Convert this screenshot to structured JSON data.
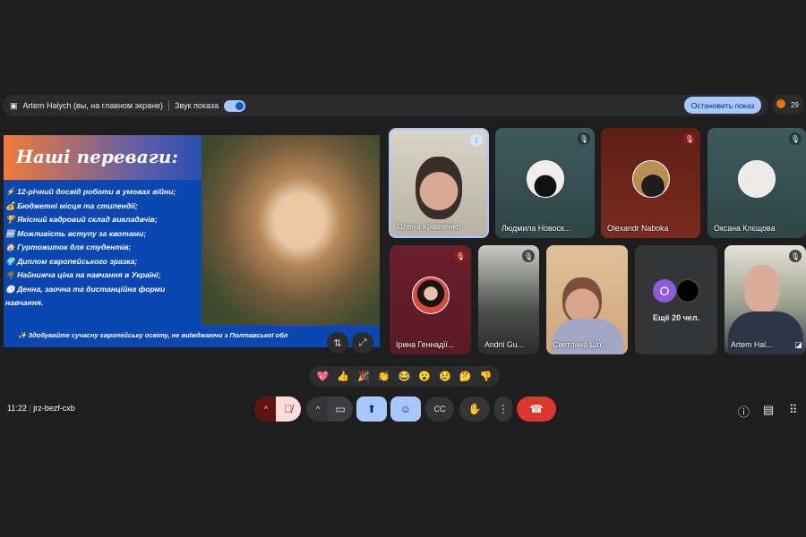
{
  "topbar": {
    "presenter": "Artem Halych (вы, на главном экране)",
    "sound_label": "Звук показа",
    "stop_label": "Остановить показ",
    "participant_count": "29"
  },
  "slide": {
    "title": "Наші переваги:",
    "items": [
      "⚡ 12-річний досвід роботи в умовах війни;",
      "💰 Бюджетні місця та стипендії;",
      "🏆 Якісний кадровий склад викладачів;",
      "🆓 Можливість вступу за квотами;",
      "🏠 Гуртожиток для студентів;",
      "🌍 Диплом європейського зразка;",
      "🌴 Найнижча ціна на навчання в Україні;",
      "🕒 Денна, заочна та дистанційна форми навчання."
    ],
    "footer": "✨ Здобувайте сучасну європейську освіту, не виїжджаючи з Полтавської обл"
  },
  "tiles": [
    {
      "name": "Олена Кравченко",
      "state": "speaking"
    },
    {
      "name": "Людмила Новоск...",
      "state": "muted"
    },
    {
      "name": "Olexandr Naboka",
      "state": "muted"
    },
    {
      "name": "Оксана Клєщова",
      "state": "muted"
    },
    {
      "name": "Ірина Геннадії...",
      "state": "muted"
    },
    {
      "name": "Andrii Gu...",
      "state": "muted"
    },
    {
      "name": "Светлана Шп...",
      "state": "video"
    },
    {
      "name": "Ещё 20 чел.",
      "avatar_letter": "O"
    },
    {
      "name": "Artem Hal...",
      "state": "muted"
    }
  ],
  "reactions": [
    "💖",
    "👍",
    "🎉",
    "👏",
    "😂",
    "😮",
    "😢",
    "🤔",
    "👎"
  ],
  "footer": {
    "time": "11:22",
    "meeting_code": "jrz-bezf-cxb"
  },
  "colors": {
    "accent": "#a8c7fa",
    "end_call": "#dc362e",
    "mic_off": "#f9dedc"
  }
}
